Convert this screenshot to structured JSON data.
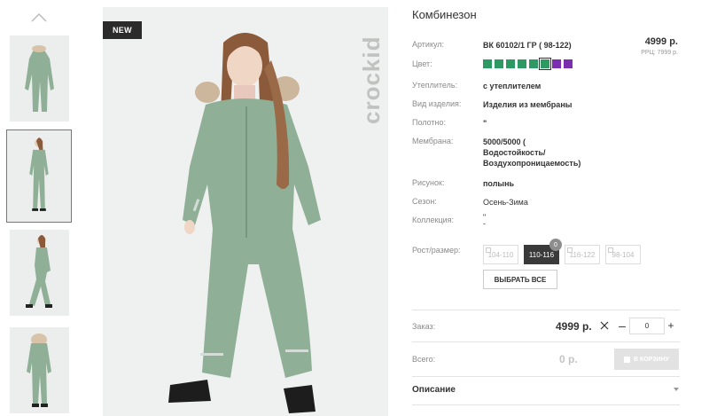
{
  "product": {
    "title": "Комбинезон",
    "badge": "NEW",
    "brand": "crockid",
    "price": "4999 р.",
    "rrp": "РРЦ: 7999 р."
  },
  "attributes": [
    {
      "label": "Артикул:",
      "value": "ВК 60102/1 ГР ( 98-122)"
    },
    {
      "label": "Цвет:",
      "value": ""
    },
    {
      "label": "Утеплитель:",
      "value": "с утеплителем"
    },
    {
      "label": "Вид изделия:",
      "value": "Изделия из мембраны"
    },
    {
      "label": "Полотно:",
      "value": "\""
    },
    {
      "label": "Мембрана:",
      "value_lines": [
        "5000/5000 (",
        "Водостойкость/",
        "Воздухопроницаемость)"
      ]
    },
    {
      "label": "Рисунок:",
      "value": "полынь"
    },
    {
      "label": "Сезон:",
      "value": "Осень-Зима"
    },
    {
      "label": "Коллекция:",
      "value_lines": [
        "\"",
        "-"
      ]
    },
    {
      "label": "Рост/размер:",
      "value": ""
    }
  ],
  "swatches": [
    {
      "color": "#2e9a63",
      "selected": false
    },
    {
      "color": "#2e9a63",
      "selected": false
    },
    {
      "color": "#2e9a63",
      "selected": false
    },
    {
      "color": "#2e9a63",
      "selected": false
    },
    {
      "color": "#2e9a63",
      "selected": false
    },
    {
      "color": "#2e9a63",
      "selected": true
    },
    {
      "color": "#7b2fb0",
      "selected": false
    },
    {
      "color": "#7b2fb0",
      "selected": false
    }
  ],
  "sizes": [
    {
      "label": "104-110",
      "selected": false,
      "count": ""
    },
    {
      "label": "110-116",
      "selected": true,
      "count": "0"
    },
    {
      "label": "116-122",
      "selected": false,
      "count": ""
    },
    {
      "label": "98-104",
      "selected": false,
      "count": ""
    }
  ],
  "select_all_label": "ВЫБРАТЬ ВСЕ",
  "order": {
    "label": "Заказ:",
    "price": "4999 р.",
    "quantity": "0",
    "minus": "–",
    "plus": "+"
  },
  "total": {
    "label": "Всего:",
    "value": "0 р.",
    "cart_label": "В КОРЗИНУ"
  },
  "description_label": "Описание",
  "colors": {
    "accent_dark": "#3a3a3a",
    "suit_green": "#8fb097",
    "cart_disabled": "#e2e2e2"
  }
}
